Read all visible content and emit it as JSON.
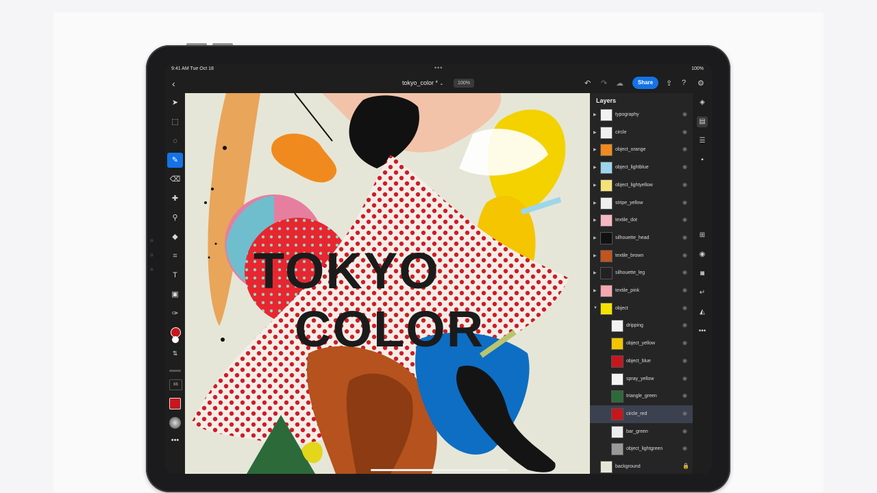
{
  "status": {
    "time": "9:41 AM  Tue Oct 18",
    "battery": "100%"
  },
  "topbar": {
    "back_icon": "‹",
    "title": "tokyo_color *",
    "zoom": "100%",
    "share_label": "Share"
  },
  "poster": {
    "line1": "TOKYO",
    "line2": "COLOR"
  },
  "toolbar": {
    "brush_size": "66"
  },
  "layers": {
    "title": "Layers",
    "items": [
      {
        "label": "typography"
      },
      {
        "label": "circle"
      },
      {
        "label": "object_orange"
      },
      {
        "label": "object_lightblue"
      },
      {
        "label": "object_lightyellow"
      },
      {
        "label": "stripe_yellow"
      },
      {
        "label": "textile_dot"
      },
      {
        "label": "silhouette_head"
      },
      {
        "label": "textile_brown"
      },
      {
        "label": "silhouette_leg"
      },
      {
        "label": "textile_pink"
      },
      {
        "label": "object"
      },
      {
        "label": "dripping"
      },
      {
        "label": "object_yellow"
      },
      {
        "label": "object_blue"
      },
      {
        "label": "spray_yellow"
      },
      {
        "label": "triangle_green"
      },
      {
        "label": "circle_red"
      },
      {
        "label": "bar_green"
      },
      {
        "label": "object_lightgreen"
      },
      {
        "label": "background"
      }
    ]
  },
  "colors": {
    "accent": "#1473e6",
    "foreground_color": "#c8161d",
    "background_color": "#ffffff"
  }
}
